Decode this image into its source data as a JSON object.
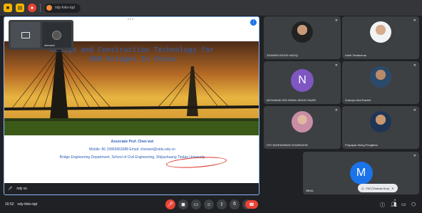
{
  "browser": {
    "url_text": "ndy-fokn-tqd"
  },
  "stage": {
    "dots": "•••",
    "presenter_label": "zhenwei",
    "slide": {
      "title_line1": "Design and Construction Technology for",
      "title_line2": "HSR Bridges In China",
      "author": "Associate Prof. Chen wei",
      "contact": "Mobile: 86 15866963688  Email: chenwei@stdu.edu.cn",
      "affiliation": "Bridge Engineering Department, School of Civil Engineering, Shijiazhuang Tiedao University"
    },
    "footer_name": "ndy vs"
  },
  "participants": [
    {
      "name": "ZHAWEN MOHD HAZIQ"
    },
    {
      "name": "Arthit Tantaveras"
    },
    {
      "name": "MOHAMAD BIN ISMAIL MOHD RAZIB",
      "initial": "N"
    },
    {
      "name": "Zulaziyo Mat Rashid"
    },
    {
      "name": "SITI NURHASBIAH KHAIRUDIN"
    },
    {
      "name": "Prapapar Mong Pengfeea"
    }
  ],
  "self": {
    "name": "NBVA",
    "initial": "M",
    "pill_label": "FW (Thomas Kun)"
  },
  "bottombar": {
    "time": "16:52",
    "meeting_code": "ndy-fokn-tqd",
    "participant_count": "9"
  },
  "colors": {
    "accent": "#1a73e8",
    "slide_text": "#2b5fb8",
    "end_call": "#ea4335"
  }
}
